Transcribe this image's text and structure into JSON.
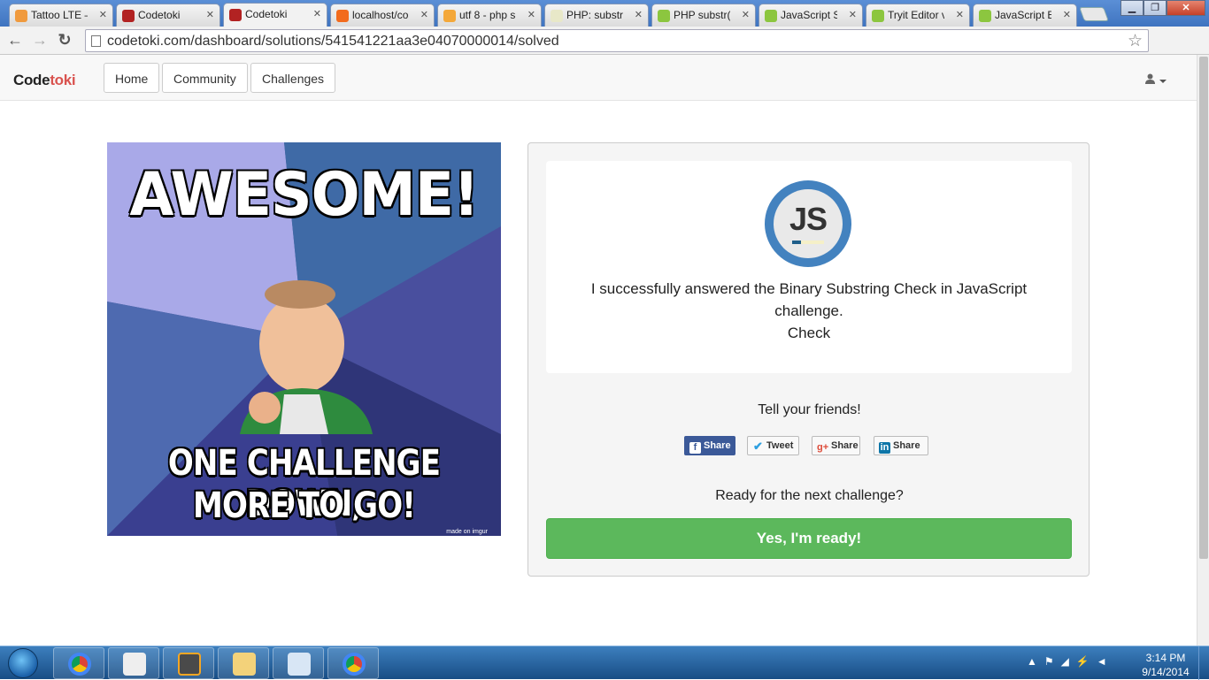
{
  "browser": {
    "tabs": [
      {
        "title": "Tattoo LTE –",
        "fav_color": "#f09a3e"
      },
      {
        "title": "Codetoki",
        "fav_color": "#b22222"
      },
      {
        "title": "Codetoki",
        "fav_color": "#b22222",
        "active": true
      },
      {
        "title": "localhost/co",
        "fav_color": "#f26b1d"
      },
      {
        "title": "utf 8 - php s",
        "fav_color": "#f4a83a"
      },
      {
        "title": "PHP: substr",
        "fav_color": "#e8e8c8"
      },
      {
        "title": "PHP substr()",
        "fav_color": "#8cc63f"
      },
      {
        "title": "JavaScript St",
        "fav_color": "#8cc63f"
      },
      {
        "title": "Tryit Editor v",
        "fav_color": "#8cc63f"
      },
      {
        "title": "JavaScript Br",
        "fav_color": "#8cc63f"
      }
    ],
    "tab_close_glyph": "✕",
    "url": "codetoki.com/dashboard/solutions/541541221aa3e04070000014/solved",
    "back_glyph": "←",
    "forward_glyph": "→",
    "reload_glyph": "↻",
    "star_glyph": "☆",
    "win_min": "▁",
    "win_max": "❐",
    "win_close": "✕"
  },
  "navbar": {
    "brand_code": "Code",
    "brand_toki": "toki",
    "links": [
      "Home",
      "Community",
      "Challenges"
    ],
    "user_icon": "user-icon"
  },
  "meme": {
    "top_text": "AWESOME!",
    "bottom_line1": "ONE CHALLENGE DOWN,",
    "bottom_line2": "MORE TO GO!",
    "watermark": "made on imgur"
  },
  "card": {
    "badge_text": "JS",
    "message_line1": "I successfully answered the Binary Substring Check in JavaScript",
    "message_line2": "challenge.",
    "message_line3": "Check"
  },
  "social": {
    "tell": "Tell your friends!",
    "facebook": "Share",
    "twitter": "Tweet",
    "gplus": "Share",
    "linkedin": "Share"
  },
  "next": {
    "question": "Ready for the next challenge?",
    "button": "Yes, I'm ready!"
  },
  "taskbar": {
    "time": "3:14 PM",
    "date": "9/14/2014",
    "tray_glyphs": "▲⚑◢⚡◄"
  },
  "colors": {
    "accent_green": "#5cb85c",
    "brand_red": "#d9534f",
    "badge_blue": "#4382bf",
    "facebook": "#3b5998"
  }
}
